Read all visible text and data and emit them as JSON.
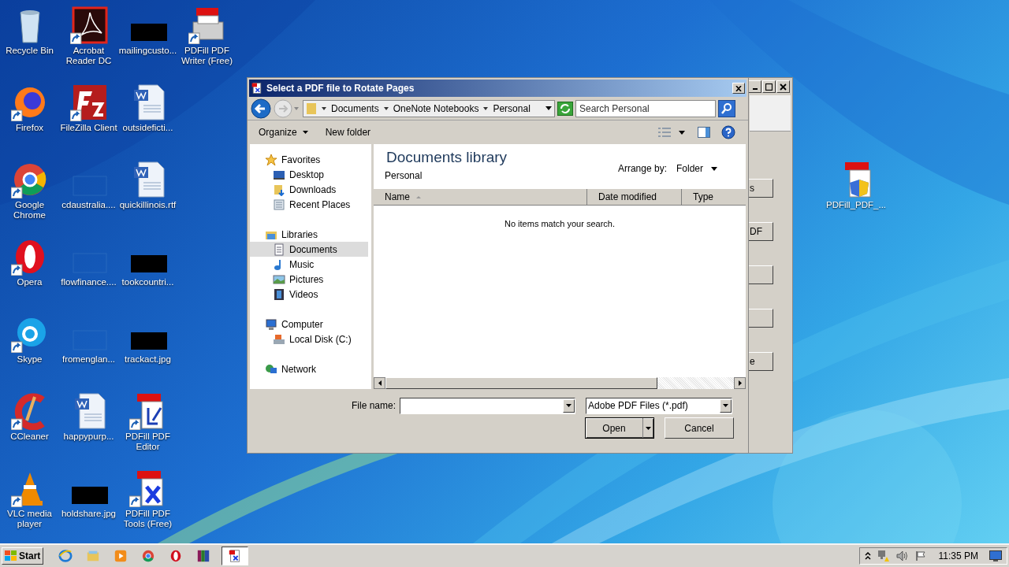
{
  "desktop": {
    "icons": [
      {
        "label": "Recycle Bin",
        "kind": "recycle",
        "shortcut": false
      },
      {
        "label": "Firefox",
        "kind": "firefox",
        "shortcut": true
      },
      {
        "label": "Google Chrome",
        "kind": "chrome",
        "shortcut": true
      },
      {
        "label": "Opera",
        "kind": "opera",
        "shortcut": true
      },
      {
        "label": "Skype",
        "kind": "skype",
        "shortcut": true
      },
      {
        "label": "CCleaner",
        "kind": "ccleaner",
        "shortcut": true
      },
      {
        "label": "VLC media player",
        "kind": "vlc",
        "shortcut": true
      },
      {
        "label": "Acrobat Reader DC",
        "kind": "acrobat",
        "shortcut": true
      },
      {
        "label": "FileZilla Client",
        "kind": "filezilla",
        "shortcut": true
      },
      {
        "label": "cdaustralia....",
        "kind": "blank",
        "shortcut": false
      },
      {
        "label": "flowfinance....",
        "kind": "blank",
        "shortcut": false
      },
      {
        "label": "fromenglan...",
        "kind": "blank",
        "shortcut": false
      },
      {
        "label": "happypurp...",
        "kind": "word",
        "shortcut": false
      },
      {
        "label": "holdshare.jpg",
        "kind": "black",
        "shortcut": false
      },
      {
        "label": "mailingcusto...",
        "kind": "black",
        "shortcut": false
      },
      {
        "label": "outsideficti...",
        "kind": "word",
        "shortcut": false
      },
      {
        "label": "quickillinois.rtf",
        "kind": "word",
        "shortcut": false
      },
      {
        "label": "tookcountri...",
        "kind": "black",
        "shortcut": false
      },
      {
        "label": "trackact.jpg",
        "kind": "black",
        "shortcut": false
      },
      {
        "label": "PDFill PDF Editor",
        "kind": "pdfill-editor",
        "shortcut": true
      },
      {
        "label": "PDFill PDF Tools (Free)",
        "kind": "pdfill-tools",
        "shortcut": true
      },
      {
        "label": "PDFill PDF Writer (Free)",
        "kind": "pdfill-writer",
        "shortcut": true
      }
    ],
    "extra_icon": {
      "label": "PDFill_PDF_...",
      "kind": "pdfill-setup",
      "shortcut": false
    }
  },
  "behind_window": {
    "buttons": [
      {
        "kind": "text",
        "label": "s"
      },
      {
        "kind": "text",
        "label": "DF"
      },
      {
        "kind": "blank"
      },
      {
        "kind": "blank"
      },
      {
        "kind": "text",
        "label": "e"
      }
    ]
  },
  "dialog": {
    "title": "Select a PDF file to Rotate Pages",
    "breadcrumb": [
      "Documents",
      "OneNote Notebooks",
      "Personal"
    ],
    "search": {
      "placeholder": "Search Personal"
    },
    "toolbar": [
      {
        "label": "Organize",
        "menu": true
      },
      {
        "label": "New folder",
        "menu": false
      }
    ],
    "nav": [
      {
        "label": "Favorites",
        "kind": "star",
        "selected": false,
        "children": [
          {
            "label": "Desktop",
            "kind": "desktop",
            "selected": false
          },
          {
            "label": "Downloads",
            "kind": "downloads",
            "selected": false
          },
          {
            "label": "Recent Places",
            "kind": "recent",
            "selected": false
          }
        ]
      },
      {
        "label": "Libraries",
        "kind": "libraries",
        "selected": false,
        "children": [
          {
            "label": "Documents",
            "kind": "documents",
            "selected": true
          },
          {
            "label": "Music",
            "kind": "music",
            "selected": false
          },
          {
            "label": "Pictures",
            "kind": "pictures",
            "selected": false
          },
          {
            "label": "Videos",
            "kind": "videos",
            "selected": false
          }
        ]
      },
      {
        "label": "Computer",
        "kind": "computer",
        "selected": false,
        "children": [
          {
            "label": "Local Disk (C:)",
            "kind": "disk",
            "selected": false
          }
        ]
      },
      {
        "label": "Network",
        "kind": "network",
        "selected": false
      }
    ],
    "library": {
      "title": "Documents library",
      "subtitle": "Personal",
      "arrange_label": "Arrange by:",
      "arrange_value": "Folder"
    },
    "columns": [
      {
        "label": "Name",
        "sorted": true
      },
      {
        "label": "Date modified",
        "sorted": false
      },
      {
        "label": "Type",
        "sorted": false
      }
    ],
    "empty_message": "No items match your search.",
    "file_name_label": "File name:",
    "file_type": "Adobe PDF Files (*.pdf)",
    "buttons": [
      {
        "label": "Open",
        "kind": "split"
      },
      {
        "label": "Cancel",
        "kind": "plain"
      }
    ]
  },
  "taskbar": {
    "start": "Start",
    "apps": [
      {
        "kind": "ie",
        "active": false
      },
      {
        "kind": "explorer",
        "active": false
      },
      {
        "kind": "media",
        "active": false
      },
      {
        "kind": "chrome",
        "active": false
      },
      {
        "kind": "opera",
        "active": false
      },
      {
        "kind": "winrar",
        "active": false
      },
      {
        "kind": "pdfill",
        "active": true
      }
    ],
    "clock": "11:35 PM"
  }
}
